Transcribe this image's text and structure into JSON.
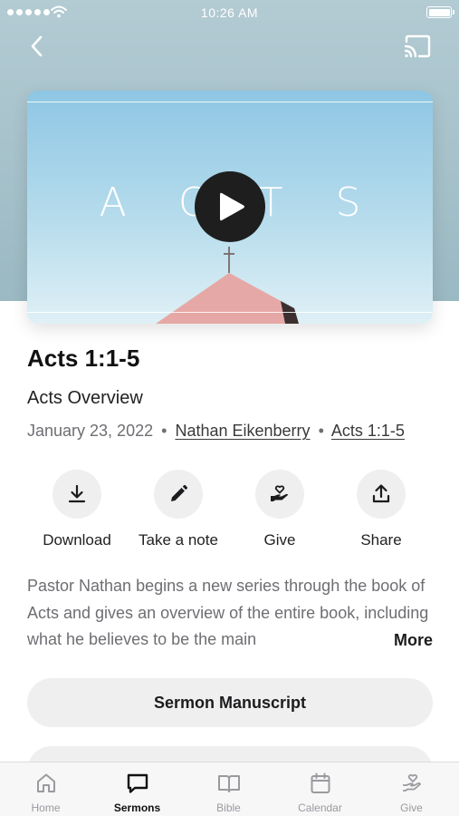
{
  "status_bar": {
    "time": "10:26 AM"
  },
  "video": {
    "title_text": "ACTS"
  },
  "sermon": {
    "title": "Acts 1:1-5",
    "series": "Acts Overview",
    "date": "January 23, 2022",
    "separator": "•",
    "speaker": "Nathan Eikenberry",
    "scripture": "Acts 1:1-5"
  },
  "actions": [
    {
      "label": "Download",
      "icon": "download-icon"
    },
    {
      "label": "Take a note",
      "icon": "pencil-icon"
    },
    {
      "label": "Give",
      "icon": "give-icon"
    },
    {
      "label": "Share",
      "icon": "share-icon"
    }
  ],
  "description": {
    "text": "Pastor Nathan begins a new series through the book of Acts and gives an overview of the entire book, including what he believes to be the main",
    "more_label": "More"
  },
  "buttons": {
    "manuscript": "Sermon Manuscript"
  },
  "tab_bar": {
    "active": "Sermons",
    "items": [
      {
        "label": "Home",
        "icon": "home-icon"
      },
      {
        "label": "Sermons",
        "icon": "sermons-icon"
      },
      {
        "label": "Bible",
        "icon": "bible-icon"
      },
      {
        "label": "Calendar",
        "icon": "calendar-icon"
      },
      {
        "label": "Give",
        "icon": "give-icon"
      }
    ]
  },
  "colors": {
    "hero_background": "#a7c3cb",
    "sky": "#9fd0e6",
    "roof": "#e8a7a4",
    "button_background": "#efeff0",
    "play_button": "#1e1e1e"
  }
}
